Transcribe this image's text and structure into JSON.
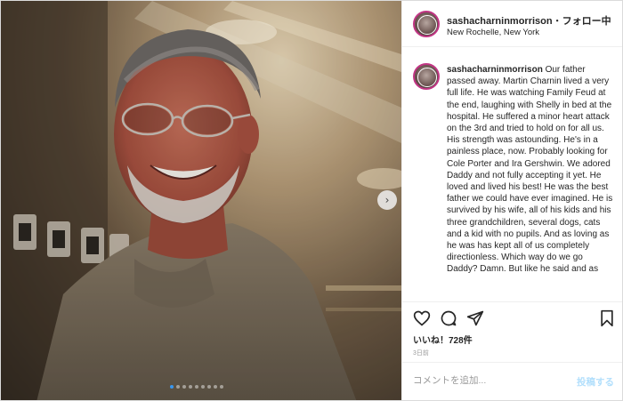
{
  "post": {
    "username": "sashacharninmorrison",
    "separator": "・",
    "follow_label": "フォロー中",
    "location": "New Rochelle, New York",
    "caption_user": "sashacharninmorrison",
    "caption_text": "Our father passed away. Martin Charnin lived a very full life. He was watching Family Feud at the end, laughing with Shelly in bed at the hospital. He suffered a minor heart attack on the 3rd and tried to hold on for all us. His strength was astounding. He's in a painless place, now. Probably looking for Cole Porter and Ira Gershwin. We adored Daddy and not fully accepting it yet. He loved and lived his best! He was the best father we could have ever imagined. He is survived by his wife, all of his kids and his three grandchildren, several dogs, cats and a kid with no pupils. And as loving as he was has kept all of us completely directionless. Which way do we go Daddy? Damn. But like he said and as",
    "likes": "いいね！728件",
    "date": "3日前",
    "comment_placeholder": "コメントを追加...",
    "post_button": "投稿する",
    "carousel": {
      "total": 9,
      "active": 0
    },
    "next_arrow": "›"
  },
  "icons": {
    "like": "heart-icon",
    "comment": "comment-bubble-icon",
    "share": "paper-plane-icon",
    "save": "bookmark-icon"
  },
  "colors": {
    "accent": "#3897f0",
    "post_disabled": "#b2dffc",
    "avatar_ring": "#c13584"
  }
}
